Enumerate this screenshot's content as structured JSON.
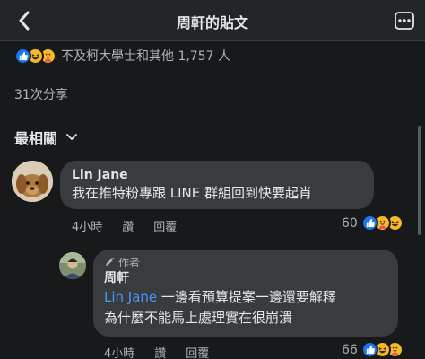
{
  "header": {
    "title": "周軒的貼文"
  },
  "reactions": {
    "summary": "不及柯大學士和其他 1,757 人",
    "icons": [
      "like-icon",
      "haha-icon",
      "care-icon"
    ],
    "colors": {
      "like": "#1877f2",
      "emoji": "#f7b928"
    }
  },
  "shares": "31次分享",
  "sort": {
    "label": "最相關"
  },
  "comments": [
    {
      "author": "Lin Jane",
      "text": "我在推特粉專跟 LINE 群組回到快要起肖",
      "time": "4小時",
      "like_label": "讚",
      "reply_label": "回覆",
      "reaction_count": "60",
      "reaction_icons": [
        "like-icon",
        "care-icon",
        "haha-icon"
      ]
    }
  ],
  "reply": {
    "badge": "作者",
    "author": "周軒",
    "mention": "Lin Jane",
    "text_line1": " 一邊看預算提案一邊還要解釋",
    "text_line2": "為什麼不能馬上處理實在很崩潰",
    "time": "4小時",
    "like_label": "讚",
    "reply_label": "回覆",
    "reaction_count": "66",
    "reaction_icons": [
      "like-icon",
      "haha-icon",
      "care-icon"
    ]
  }
}
